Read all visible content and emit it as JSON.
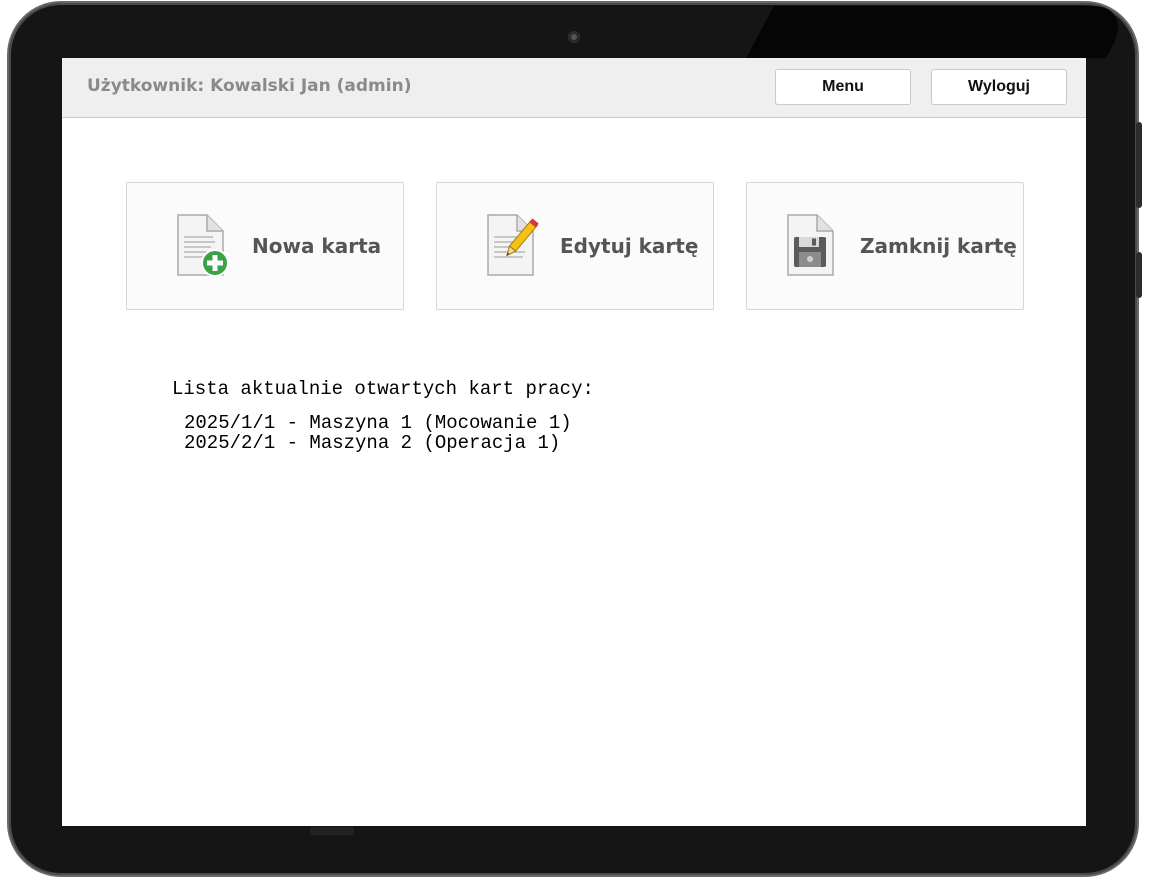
{
  "header": {
    "user_label": "Użytkownik: Kowalski Jan (admin)",
    "menu_label": "Menu",
    "logout_label": "Wyloguj"
  },
  "tiles": [
    {
      "label": "Nowa karta",
      "icon": "document-add-icon"
    },
    {
      "label": "Edytuj kartę",
      "icon": "document-edit-icon"
    },
    {
      "label": "Zamknij kartę",
      "icon": "document-save-icon"
    }
  ],
  "open_cards": {
    "title": "Lista aktualnie otwartych kart pracy:",
    "items": [
      "2025/1/1 - Maszyna 1 (Mocowanie 1)",
      "2025/2/1 - Maszyna 2 (Operacja 1)"
    ]
  },
  "colors": {
    "header_bg": "#efefef",
    "header_text": "#8a8a8a",
    "tile_text": "#555555",
    "add_green": "#3aa349",
    "pencil_yellow": "#f2c21b"
  }
}
